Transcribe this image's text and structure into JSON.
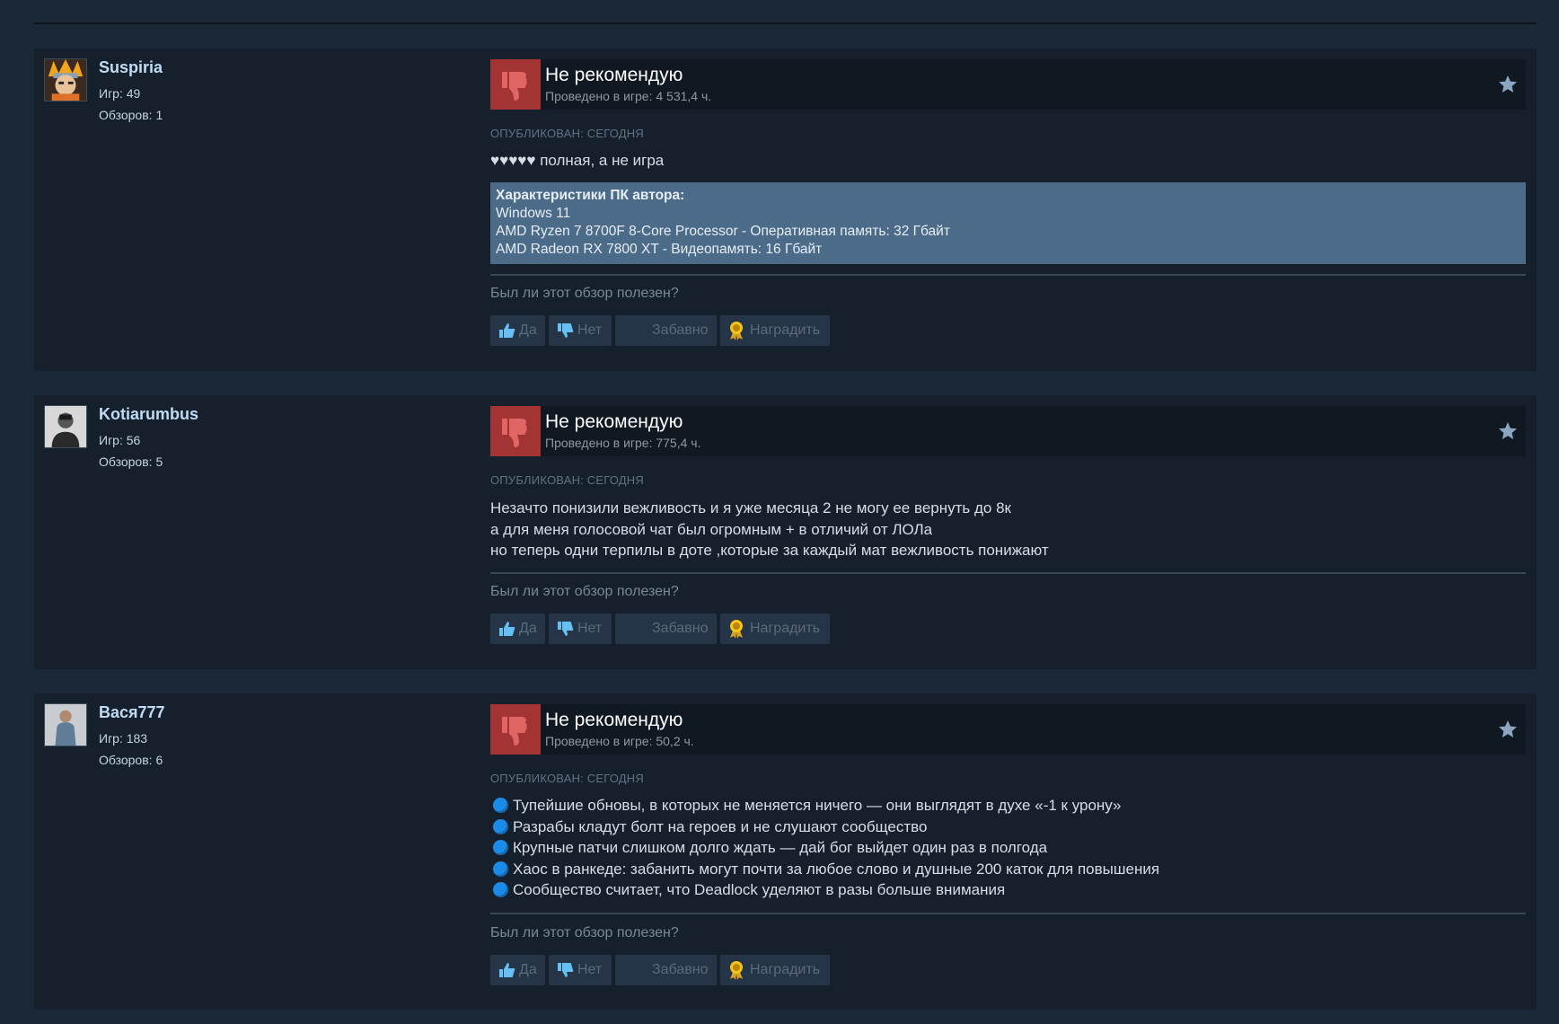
{
  "reviews": [
    {
      "author": "Suspiria",
      "games": "Игр: 49",
      "reviews_count": "Обзоров: 1",
      "verdict": "Не рекомендую",
      "hours": "Проведено в игре: 4 531,4 ч.",
      "posted": "Опубликован: сегодня",
      "text_lines": [
        "♥♥♥♥♥ полная, а не игра"
      ],
      "specs": {
        "title": "Характеристики ПК автора:",
        "lines": [
          "Windows 11",
          "AMD Ryzen 7 8700F 8-Core Processor - Оперативная память: 32 Гбайт",
          "AMD Radeon RX 7800 XT - Видеопамять: 16 Гбайт"
        ]
      }
    },
    {
      "author": "Kotiarumbus",
      "games": "Игр: 56",
      "reviews_count": "Обзоров: 5",
      "verdict": "Не рекомендую",
      "hours": "Проведено в игре: 775,4 ч.",
      "posted": "Опубликован: сегодня",
      "text_lines": [
        "Незачто понизили вежливость и я уже месяца 2 не могу ее вернуть до 8к",
        "а для меня голосовой чат был огромным + в отличий от ЛОЛа",
        "но теперь одни терпилы в доте ,которые за каждый мат вежливость понижают"
      ]
    },
    {
      "author": "Вася777",
      "games": "Игр: 183",
      "reviews_count": "Обзоров: 6",
      "verdict": "Не рекомендую",
      "hours": "Проведено в игре: 50,2 ч.",
      "posted": "Опубликован: сегодня",
      "bullets": [
        "Тупейшие обновы, в которых не меняется ничего — они выглядят в духе «-1 к урону»",
        "Разрабы кладут болт на героев и не слушают сообщество",
        "Крупные патчи слишком долго ждать — дай бог выйдет один раз в полгода",
        "Хаос в ранкеде: забанить могут почти за любое слово и душные 200 каток для повышения",
        "Сообщество считает, что Deadlock уделяют в разы больше внимания"
      ]
    }
  ],
  "helpful": {
    "question": "Был ли этот обзор полезен?",
    "yes": "Да",
    "no": "Нет",
    "funny": "Забавно",
    "award": "Наградить"
  },
  "colors": {
    "page_bg": "#1b2838",
    "card_bg": "#16202d",
    "thumb_down_bg": "#a33434",
    "specs_bg": "#4c6b89",
    "bullet_blue": "#1c8be8",
    "award_gold": "#f5c518"
  },
  "icons": {
    "verdict": "thumbs-down-icon",
    "favorite": "star-icon",
    "yes": "thumbs-up-icon",
    "no": "thumbs-down-icon",
    "award": "award-icon"
  }
}
